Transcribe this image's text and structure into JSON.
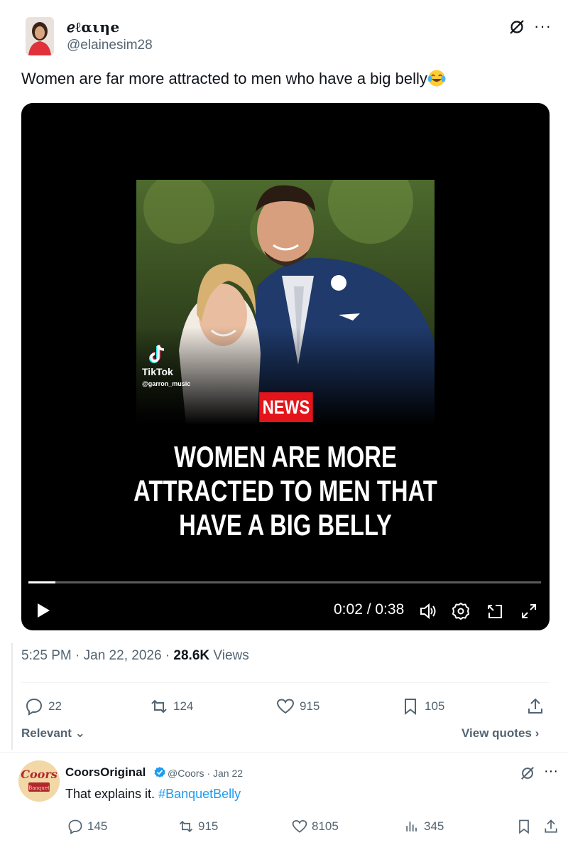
{
  "tweet": {
    "display_name": "ℯℓαιηe",
    "handle": "@elainesim28",
    "text": "Women are far more attracted to men who have a big belly",
    "emoji": "face-with-tears-of-joy",
    "video": {
      "watermark_app": "TikTok",
      "watermark_user": "@garron_music",
      "badge": "NEWS",
      "headline_lines": [
        "WOMEN ARE MORE",
        "ATTRACTED TO MEN THAT",
        "HAVE A BIG BELLY"
      ],
      "time": "0:02 / 0:38",
      "progress": 0.052
    },
    "time_label": "5:25 PM · Jan 22, 2026 · ",
    "views_count": "28.6K",
    "views_label": " Views",
    "actions": {
      "replies": "22",
      "reposts": "124",
      "likes": "915",
      "bookmarks": "105"
    },
    "sort_label": "Relevant",
    "view_quotes_label": "View quotes"
  },
  "reply": {
    "name": "CoorsOriginal",
    "handle_date": "@Coors · Jan 22",
    "text": "That explains it. ",
    "hashtag": "#BanquetBelly",
    "avatar_text": "Coors",
    "avatar_subtext": "Banquet",
    "actions": {
      "replies": "145",
      "reposts": "915",
      "likes": "8105",
      "views": "345"
    }
  },
  "colors": {
    "link": "#1d9bf0",
    "muted": "#536471",
    "news_red": "#e4141b",
    "verified": "#1d9bf0"
  }
}
